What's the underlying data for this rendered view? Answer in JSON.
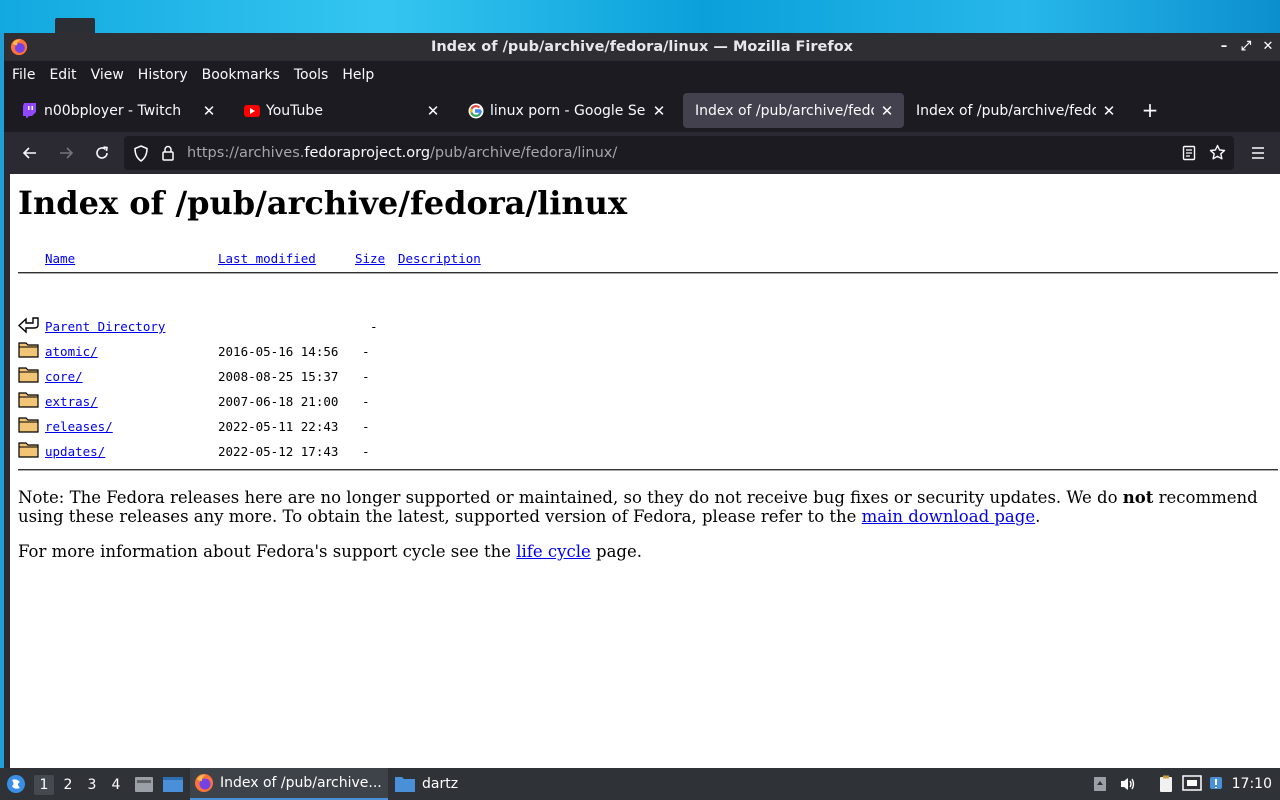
{
  "window": {
    "title": "Index of /pub/archive/fedora/linux — Mozilla Firefox"
  },
  "menu": [
    "File",
    "Edit",
    "View",
    "History",
    "Bookmarks",
    "Tools",
    "Help"
  ],
  "tabs": [
    {
      "label": "n00bployer - Twitch",
      "icon": "twitch-icon",
      "active": false
    },
    {
      "label": "YouTube",
      "icon": "youtube-icon",
      "active": false
    },
    {
      "label": "linux porn - Google Search",
      "icon": "google-icon",
      "active": false
    },
    {
      "label": "Index of /pub/archive/fedora",
      "icon": "",
      "active": true
    },
    {
      "label": "Index of /pub/archive/fedora",
      "icon": "",
      "active": false
    }
  ],
  "urlbar": {
    "prefix": "https://archives.",
    "domain": "fedoraproject.org",
    "path": "/pub/archive/fedora/linux/"
  },
  "page": {
    "heading": "Index of /pub/archive/fedora/linux",
    "columns": {
      "name": "Name",
      "modified": "Last modified",
      "size": "Size",
      "description": "Description"
    },
    "entries": [
      {
        "name": "Parent Directory",
        "modified": "",
        "size": "-",
        "icon": "back-arrow-icon"
      },
      {
        "name": "atomic/",
        "modified": "2016-05-16 14:56",
        "size": "-",
        "icon": "folder-icon"
      },
      {
        "name": "core/",
        "modified": "2008-08-25 15:37",
        "size": "-",
        "icon": "folder-icon"
      },
      {
        "name": "extras/",
        "modified": "2007-06-18 21:00",
        "size": "-",
        "icon": "folder-icon"
      },
      {
        "name": "releases/",
        "modified": "2022-05-11 22:43",
        "size": "-",
        "icon": "folder-icon"
      },
      {
        "name": "updates/",
        "modified": "2022-05-12 17:43",
        "size": "-",
        "icon": "folder-icon"
      }
    ],
    "note": {
      "part1": "Note: The Fedora releases here are no longer supported or maintained, so they do not receive bug fixes or security updates. We do ",
      "bold": "not",
      "part2": " recommend using these releases any more. To obtain the latest, supported version of Fedora, please refer to the ",
      "link": "main download page",
      "part3": "."
    },
    "note2": {
      "part1": "For more information about Fedora's support cycle see the ",
      "link": "life cycle",
      "part2": " page."
    }
  },
  "taskbar": {
    "workspaces": [
      "1",
      "2",
      "3",
      "4"
    ],
    "current_workspace": "1",
    "tasks": [
      {
        "label": "Index of /pub/archive...",
        "active": true
      },
      {
        "label": "dartz",
        "active": false
      }
    ],
    "clock": "17:10"
  }
}
